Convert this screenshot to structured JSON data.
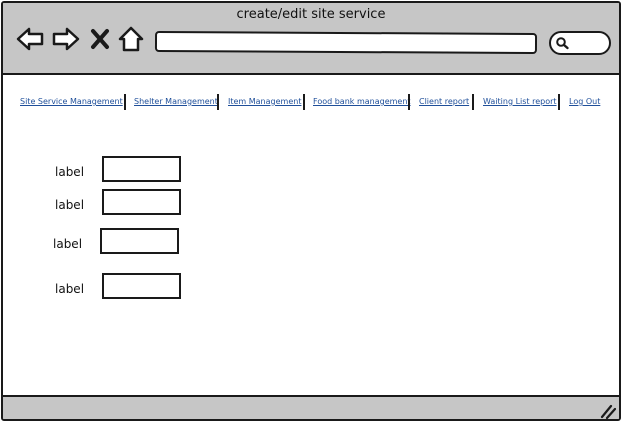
{
  "window": {
    "title": "create/edit site service"
  },
  "toolbar": {
    "back_icon": "arrow-left-icon",
    "forward_icon": "arrow-right-icon",
    "stop_icon": "close-icon",
    "home_icon": "home-icon",
    "address_value": "",
    "search_icon": "search-icon"
  },
  "menu": {
    "items": [
      {
        "label": "Site Service Management"
      },
      {
        "label": "Shelter Management"
      },
      {
        "label": "Item Management"
      },
      {
        "label": "Food bank management"
      },
      {
        "label": "Client report"
      },
      {
        "label": "Waiting List report"
      },
      {
        "label": "Log Out"
      }
    ]
  },
  "form": {
    "fields": [
      {
        "label": "label",
        "value": ""
      },
      {
        "label": "label",
        "value": ""
      },
      {
        "label": "label",
        "value": ""
      },
      {
        "label": "label",
        "value": ""
      }
    ]
  },
  "colors": {
    "chrome": "#c6c6c6",
    "border": "#1a1a1a",
    "link": "#1f4f9a",
    "background": "#ffffff"
  }
}
